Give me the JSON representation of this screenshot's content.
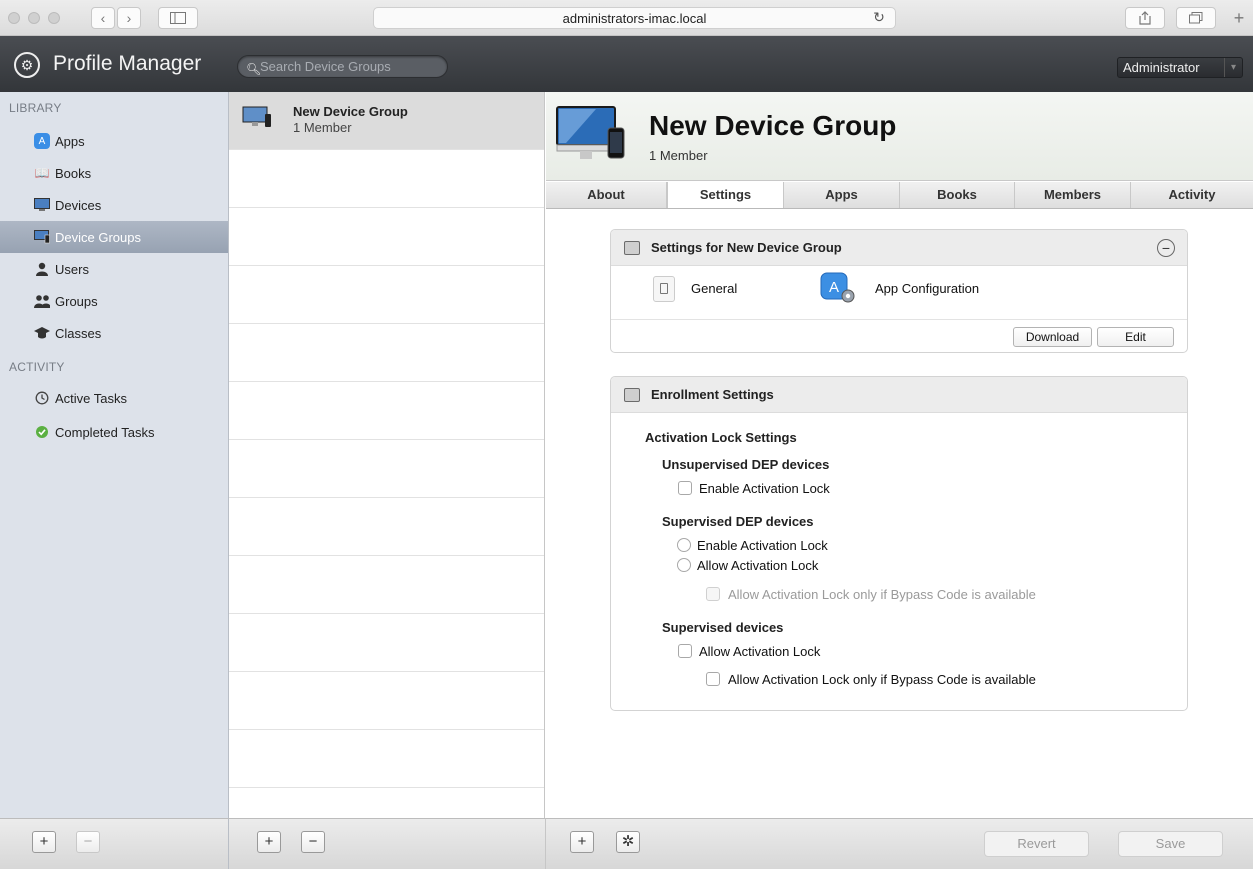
{
  "browser": {
    "url": "administrators-imac.local"
  },
  "header": {
    "title": "Profile Manager",
    "search_placeholder": "Search Device Groups",
    "user_menu": "Administrator"
  },
  "sidebar": {
    "library_heading": "LIBRARY",
    "activity_heading": "ACTIVITY",
    "items": [
      {
        "label": "Apps"
      },
      {
        "label": "Books"
      },
      {
        "label": "Devices"
      },
      {
        "label": "Device Groups"
      },
      {
        "label": "Users"
      },
      {
        "label": "Groups"
      },
      {
        "label": "Classes"
      }
    ],
    "activity_items": [
      {
        "label": "Active Tasks"
      },
      {
        "label": "Completed Tasks"
      }
    ]
  },
  "list": {
    "items": [
      {
        "title": "New Device Group",
        "subtitle": "1 Member"
      }
    ]
  },
  "detail": {
    "title": "New Device Group",
    "subtitle": "1 Member",
    "tabs": [
      "About",
      "Settings",
      "Apps",
      "Books",
      "Members",
      "Activity"
    ],
    "active_tab": "Settings",
    "settings_panel": {
      "title": "Settings for New Device Group",
      "payloads": [
        "General",
        "App Configuration"
      ],
      "download_label": "Download",
      "edit_label": "Edit"
    },
    "enrollment_panel": {
      "title": "Enrollment Settings",
      "section_title": "Activation Lock Settings",
      "unsupervised_dep_title": "Unsupervised DEP devices",
      "unsupervised_dep_enable": "Enable Activation Lock",
      "supervised_dep_title": "Supervised DEP devices",
      "supervised_dep_enable": "Enable Activation Lock",
      "supervised_dep_allow": "Allow Activation Lock",
      "supervised_dep_bypass": "Allow Activation Lock only if Bypass Code is available",
      "supervised_title": "Supervised devices",
      "supervised_allow": "Allow Activation Lock",
      "supervised_bypass": "Allow Activation Lock only if Bypass Code is available"
    }
  },
  "footer": {
    "revert_label": "Revert",
    "save_label": "Save"
  },
  "colors": {
    "header_bg": "#3a3d41",
    "sidebar_bg": "#dde2ea",
    "sidebar_selected": "#9ea8b8"
  }
}
